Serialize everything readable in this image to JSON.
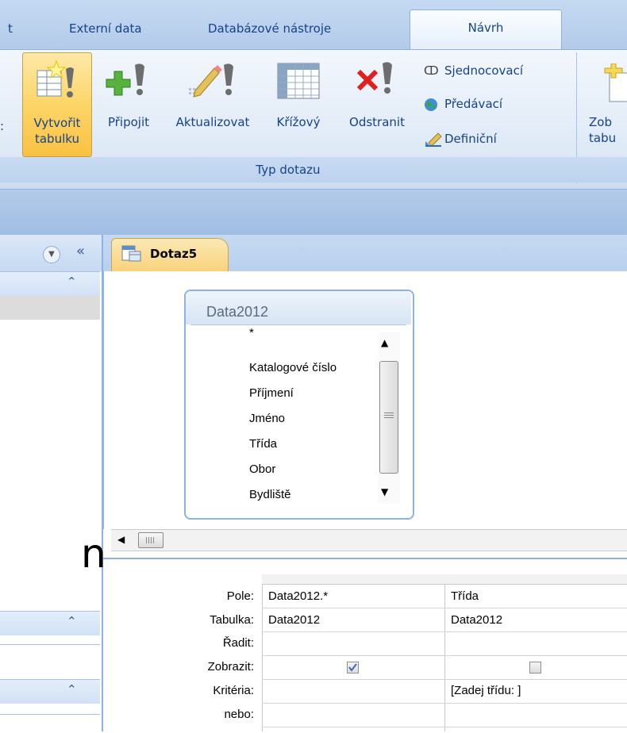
{
  "ribbon_tabs": [
    {
      "label": "t"
    },
    {
      "label": "Externí data"
    },
    {
      "label": "Databázové nástroje"
    },
    {
      "label": "Návrh"
    }
  ],
  "query_type_buttons": [
    {
      "label_line1": "Vytvořit",
      "label_line2": "tabulku",
      "icon": "make-table-icon"
    },
    {
      "label_line1": "Připojit",
      "icon": "append-icon"
    },
    {
      "label_line1": "Aktualizovat",
      "icon": "update-icon"
    },
    {
      "label_line1": "Křížový",
      "icon": "crosstab-icon"
    },
    {
      "label_line1": "Odstranit",
      "icon": "delete-icon"
    }
  ],
  "small_buttons": [
    {
      "label": "Sjednocovací",
      "icon": "union-icon"
    },
    {
      "label": "Předávací",
      "icon": "globe-icon"
    },
    {
      "label": "Definiční",
      "icon": "definition-icon"
    }
  ],
  "group_label": "Typ dotazu",
  "partial_button": {
    "line1": "Zob",
    "line2": "tabu"
  },
  "left_edge_colon": ":",
  "doc_tab": {
    "label": "Dotaz5"
  },
  "table_box": {
    "title": "Data2012",
    "fields": [
      "*",
      "Katalogové číslo",
      "Příjmení",
      "Jméno",
      "Třída",
      "Obor",
      "Bydliště"
    ]
  },
  "grid": {
    "row_labels": [
      "Pole:",
      "Tabulka:",
      "Řadit:",
      "Zobrazit:",
      "Kritéria:",
      "nebo:"
    ],
    "columns": [
      {
        "pole": "Data2012.*",
        "tabulka": "Data2012",
        "radit": "",
        "zobrazit": true,
        "kriteria": ""
      },
      {
        "pole": "Třída",
        "tabulka": "Data2012",
        "radit": "",
        "zobrazit": false,
        "kriteria": "[Zadej třídu: ]"
      }
    ]
  },
  "nav_chevrons": [
    "«",
    "⌃"
  ],
  "overlay_letter": "n"
}
